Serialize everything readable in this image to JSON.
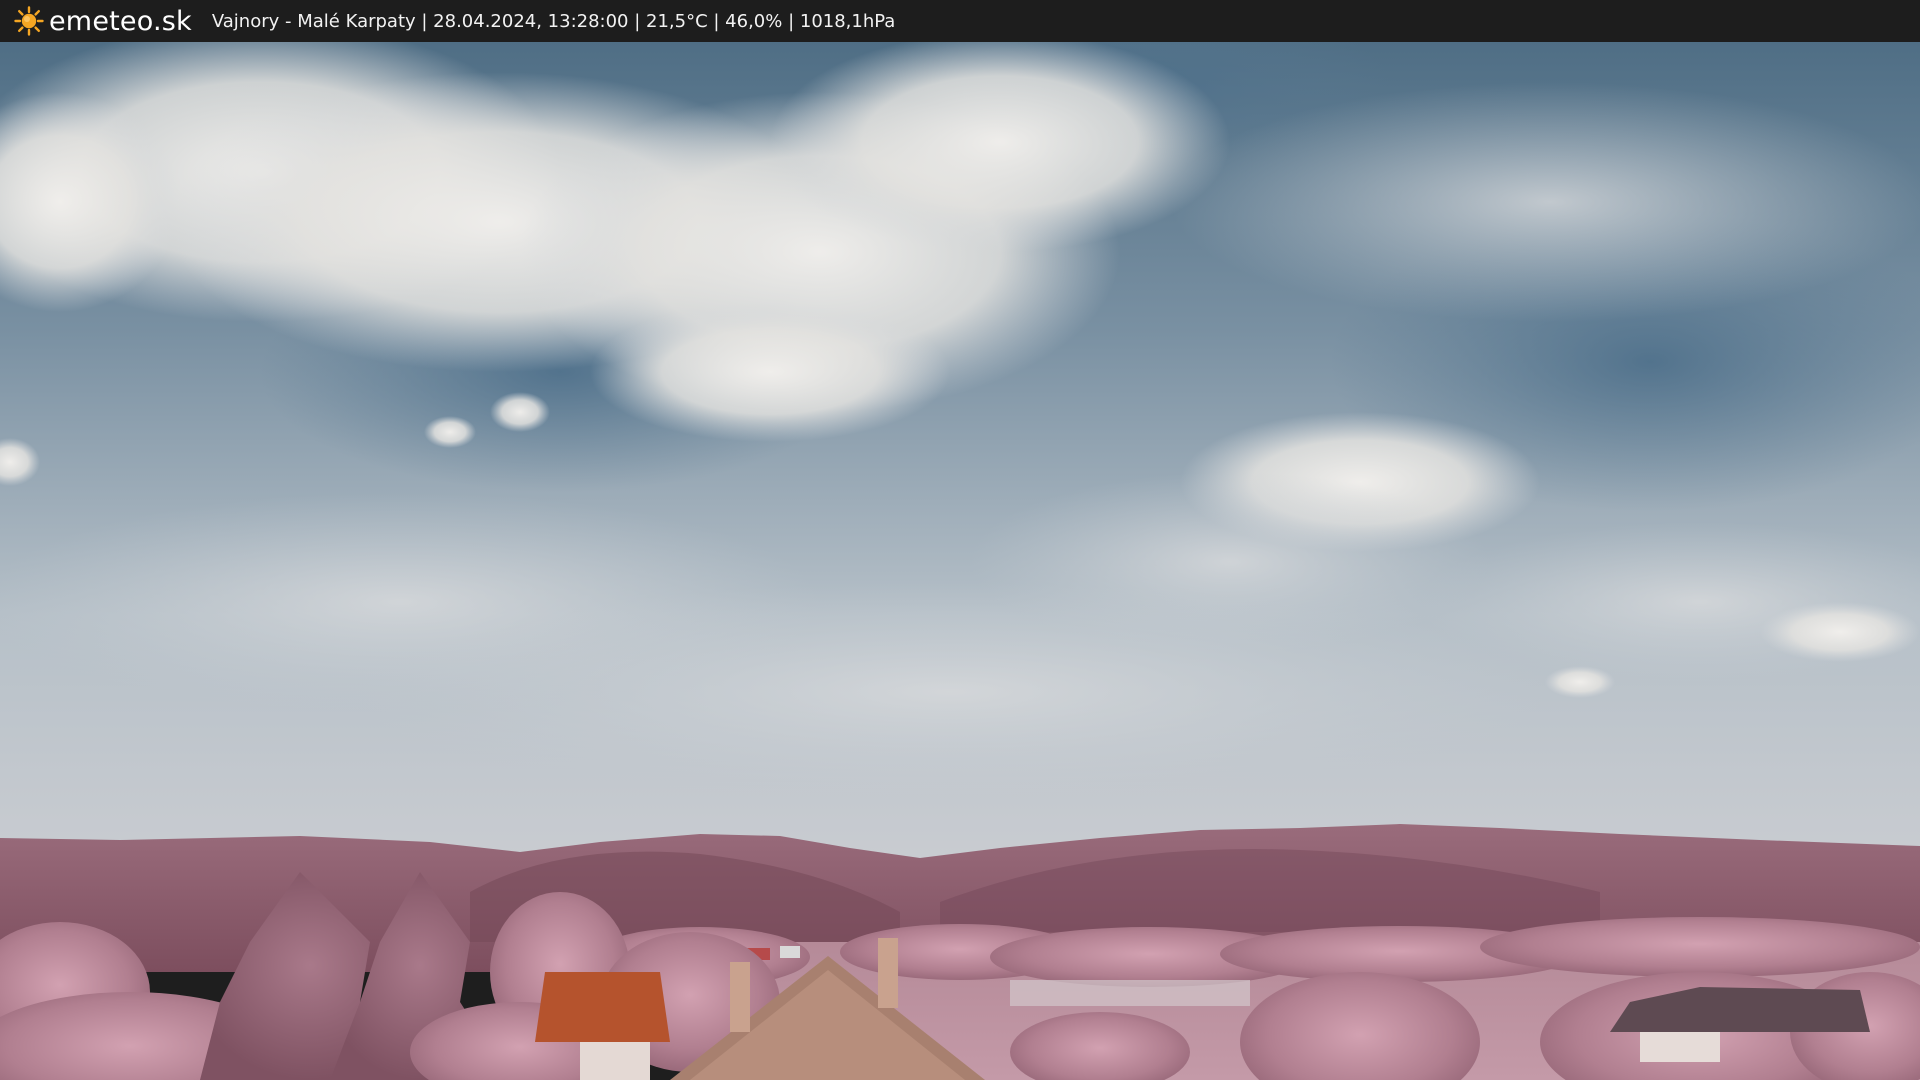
{
  "header": {
    "site_name": "emeteo.sk",
    "caption": "Vajnory - Malé Karpaty | 28.04.2024, 13:28:00 | 21,5°C | 46,0% | 1018,1hPa",
    "logo_icon": "sun-icon"
  },
  "colors": {
    "bar_background": "#1d1d1d",
    "sun": "#f5a623",
    "sky_top": "#4f6e85",
    "sky_bottom": "#c8cdd2",
    "hills": "#8a5c6c",
    "foliage": "#c08a9c",
    "roof": "#b5532d"
  }
}
